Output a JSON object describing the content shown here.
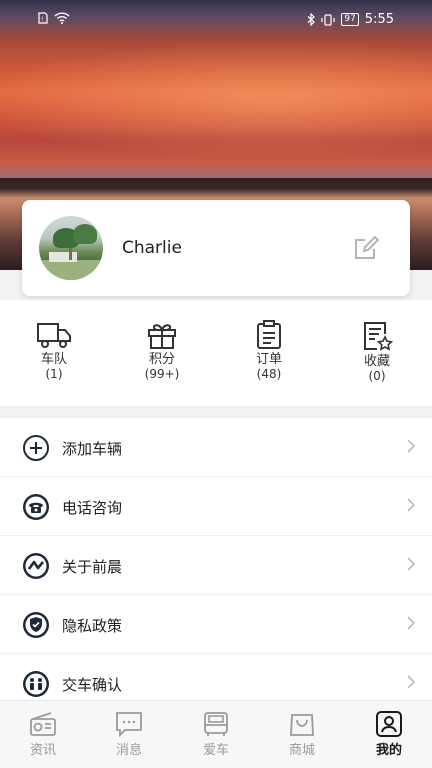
{
  "status_bar": {
    "time": "5:55",
    "battery": "97",
    "icons": [
      "sim-icon",
      "wifi-icon",
      "bluetooth-icon",
      "vibrate-icon",
      "battery-icon"
    ]
  },
  "profile": {
    "name": "Charlie",
    "edit_icon": "edit-icon"
  },
  "quick_links": [
    {
      "label": "车队",
      "count": "(1)",
      "icon": "truck-icon"
    },
    {
      "label": "积分",
      "count": "(99+)",
      "icon": "gift-icon"
    },
    {
      "label": "订单",
      "count": "(48)",
      "icon": "clipboard-icon"
    },
    {
      "label": "收藏",
      "count": "(0)",
      "icon": "favorite-doc-icon"
    }
  ],
  "menu": [
    {
      "label": "添加车辆",
      "icon": "plus-circle-icon"
    },
    {
      "label": "电话咨询",
      "icon": "phone-icon"
    },
    {
      "label": "关于前晨",
      "icon": "brand-logo-icon"
    },
    {
      "label": "隐私政策",
      "icon": "shield-icon"
    },
    {
      "label": "交车确认",
      "icon": "handover-icon"
    }
  ],
  "tabs": [
    {
      "label": "资讯",
      "icon": "radio-icon",
      "active": false
    },
    {
      "label": "消息",
      "icon": "message-icon",
      "active": false
    },
    {
      "label": "爱车",
      "icon": "bus-icon",
      "active": false
    },
    {
      "label": "商城",
      "icon": "shopping-bag-icon",
      "active": false
    },
    {
      "label": "我的",
      "icon": "user-icon",
      "active": true
    }
  ]
}
